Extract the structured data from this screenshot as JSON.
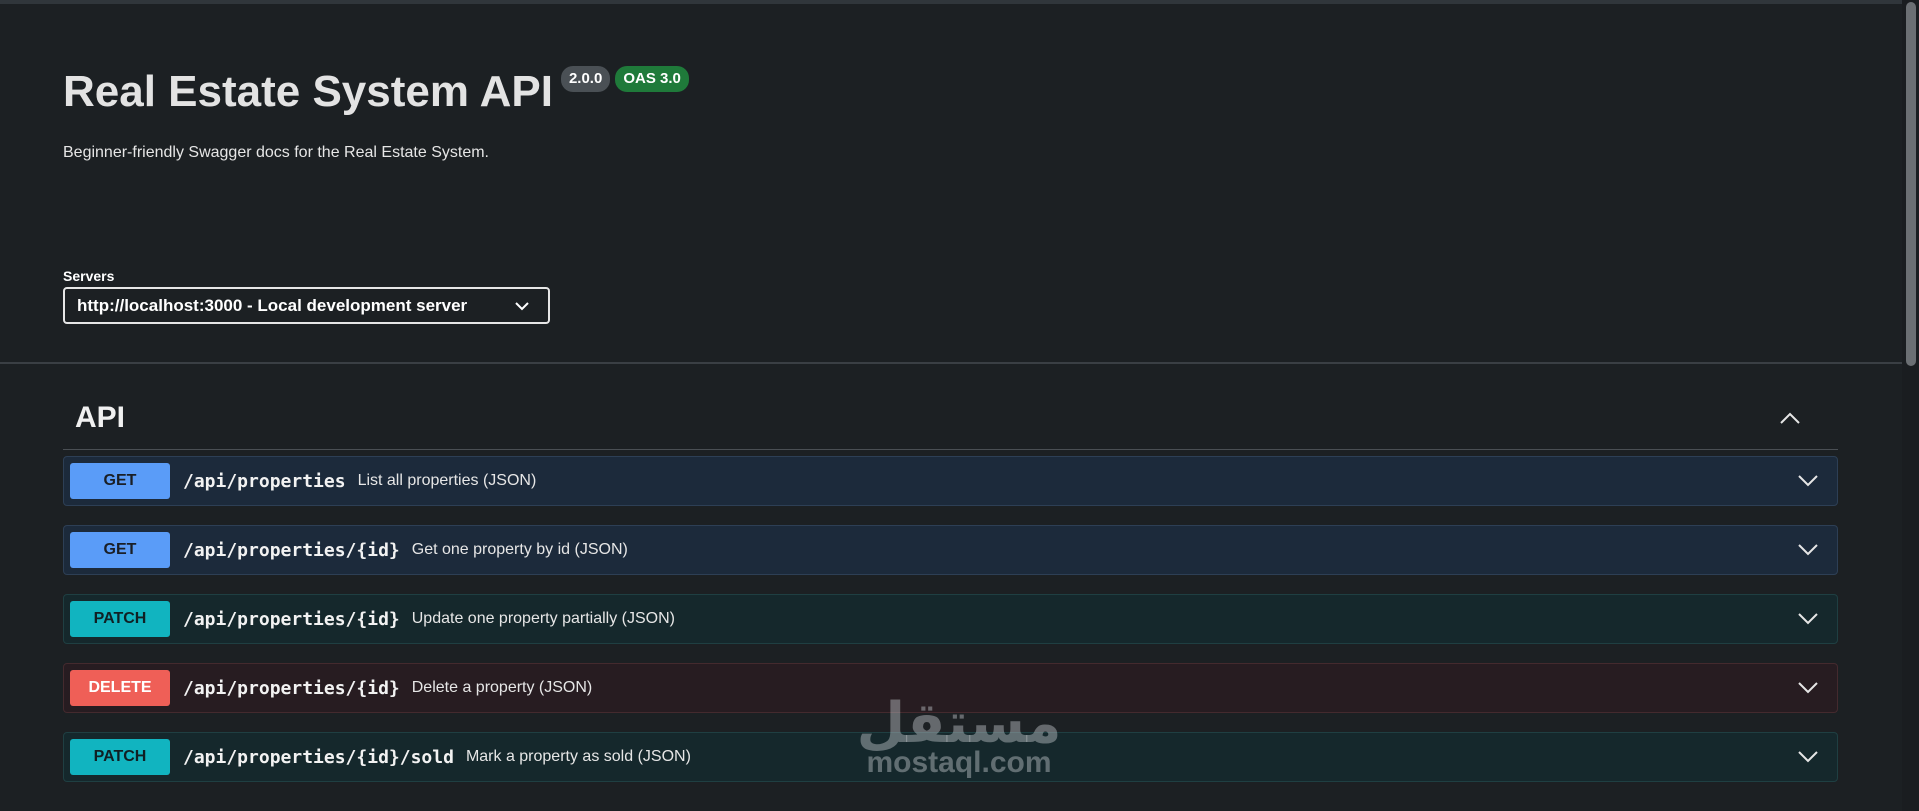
{
  "info": {
    "title": "Real Estate System API",
    "version_badge": "2.0.0",
    "oas_badge": "OAS 3.0",
    "description": "Beginner-friendly Swagger docs for the Real Estate System."
  },
  "servers": {
    "label": "Servers",
    "selected": "http://localhost:3000 - Local development server"
  },
  "section": {
    "title": "API",
    "expanded": true
  },
  "operations": [
    {
      "method": "GET",
      "path": "/api/properties",
      "summary": "List all properties (JSON)"
    },
    {
      "method": "GET",
      "path": "/api/properties/{id}",
      "summary": "Get one property by id (JSON)"
    },
    {
      "method": "PATCH",
      "path": "/api/properties/{id}",
      "summary": "Update one property partially (JSON)"
    },
    {
      "method": "DELETE",
      "path": "/api/properties/{id}",
      "summary": "Delete a property (JSON)"
    },
    {
      "method": "PATCH",
      "path": "/api/properties/{id}/sold",
      "summary": "Mark a property as sold (JSON)"
    }
  ],
  "watermark": {
    "arabic": "مستقل",
    "latin": "mostaql.com"
  },
  "colors": {
    "background": "#1c2023",
    "get": "#5a9cf8",
    "patch": "#11b4c0",
    "delete": "#ef5f57",
    "oas_badge": "#1f7a3a",
    "version_badge": "#4a5055"
  },
  "icons": {
    "server_dropdown": "chevron-down-icon",
    "section_toggle": "chevron-up-icon",
    "operation_expand": "chevron-down-icon"
  }
}
